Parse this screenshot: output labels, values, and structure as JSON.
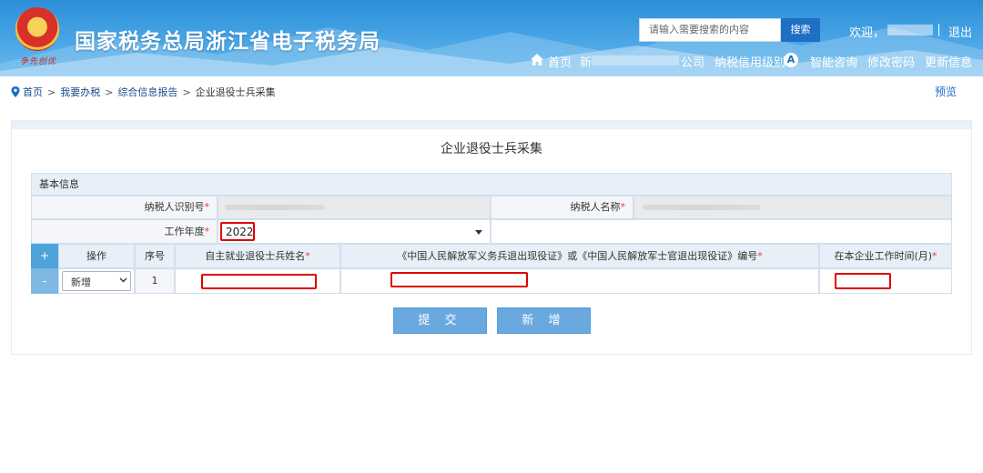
{
  "header": {
    "title": "国家税务总局浙江省电子税务局",
    "emblem_signature": "争先创优",
    "search_placeholder": "请输入需要搜索的内容",
    "search_button": "搜索",
    "welcome": "欢迎，",
    "logout": "退出",
    "nav": {
      "home": "首页",
      "company_prefix": "新",
      "company_suffix": "公司",
      "credit_grade_label": "纳税信用级别",
      "credit_grade": "A",
      "smart_consult": "智能咨询",
      "change_password": "修改密码",
      "update_info": "更新信息"
    }
  },
  "breadcrumb": [
    "首页",
    "我要办税",
    "综合信息报告",
    "企业退役士兵采集"
  ],
  "preview": "预览",
  "form": {
    "title": "企业退役士兵采集",
    "section": "基本信息",
    "taxpayer_id_label": "纳税人识别号",
    "taxpayer_name_label": "纳税人名称",
    "year_label": "工作年度",
    "year_value": "2022",
    "columns": {
      "add": "+",
      "operation": "操作",
      "seq": "序号",
      "name": "自主就业退役士兵姓名",
      "cert": "《中国人民解放军义务兵退出现役证》或《中国人民解放军士官退出现役证》编号",
      "months": "在本企业工作时间(月)"
    },
    "rows": [
      {
        "remove": "-",
        "operation": "新增",
        "seq": "1",
        "name": "",
        "cert": "",
        "months": ""
      }
    ],
    "required_mark": "*"
  },
  "buttons": {
    "submit": "提 交",
    "add": "新 增"
  },
  "colors": {
    "header_blue": "#2b8fd8",
    "button_blue": "#69a9e0",
    "highlight_red": "#e00000"
  }
}
